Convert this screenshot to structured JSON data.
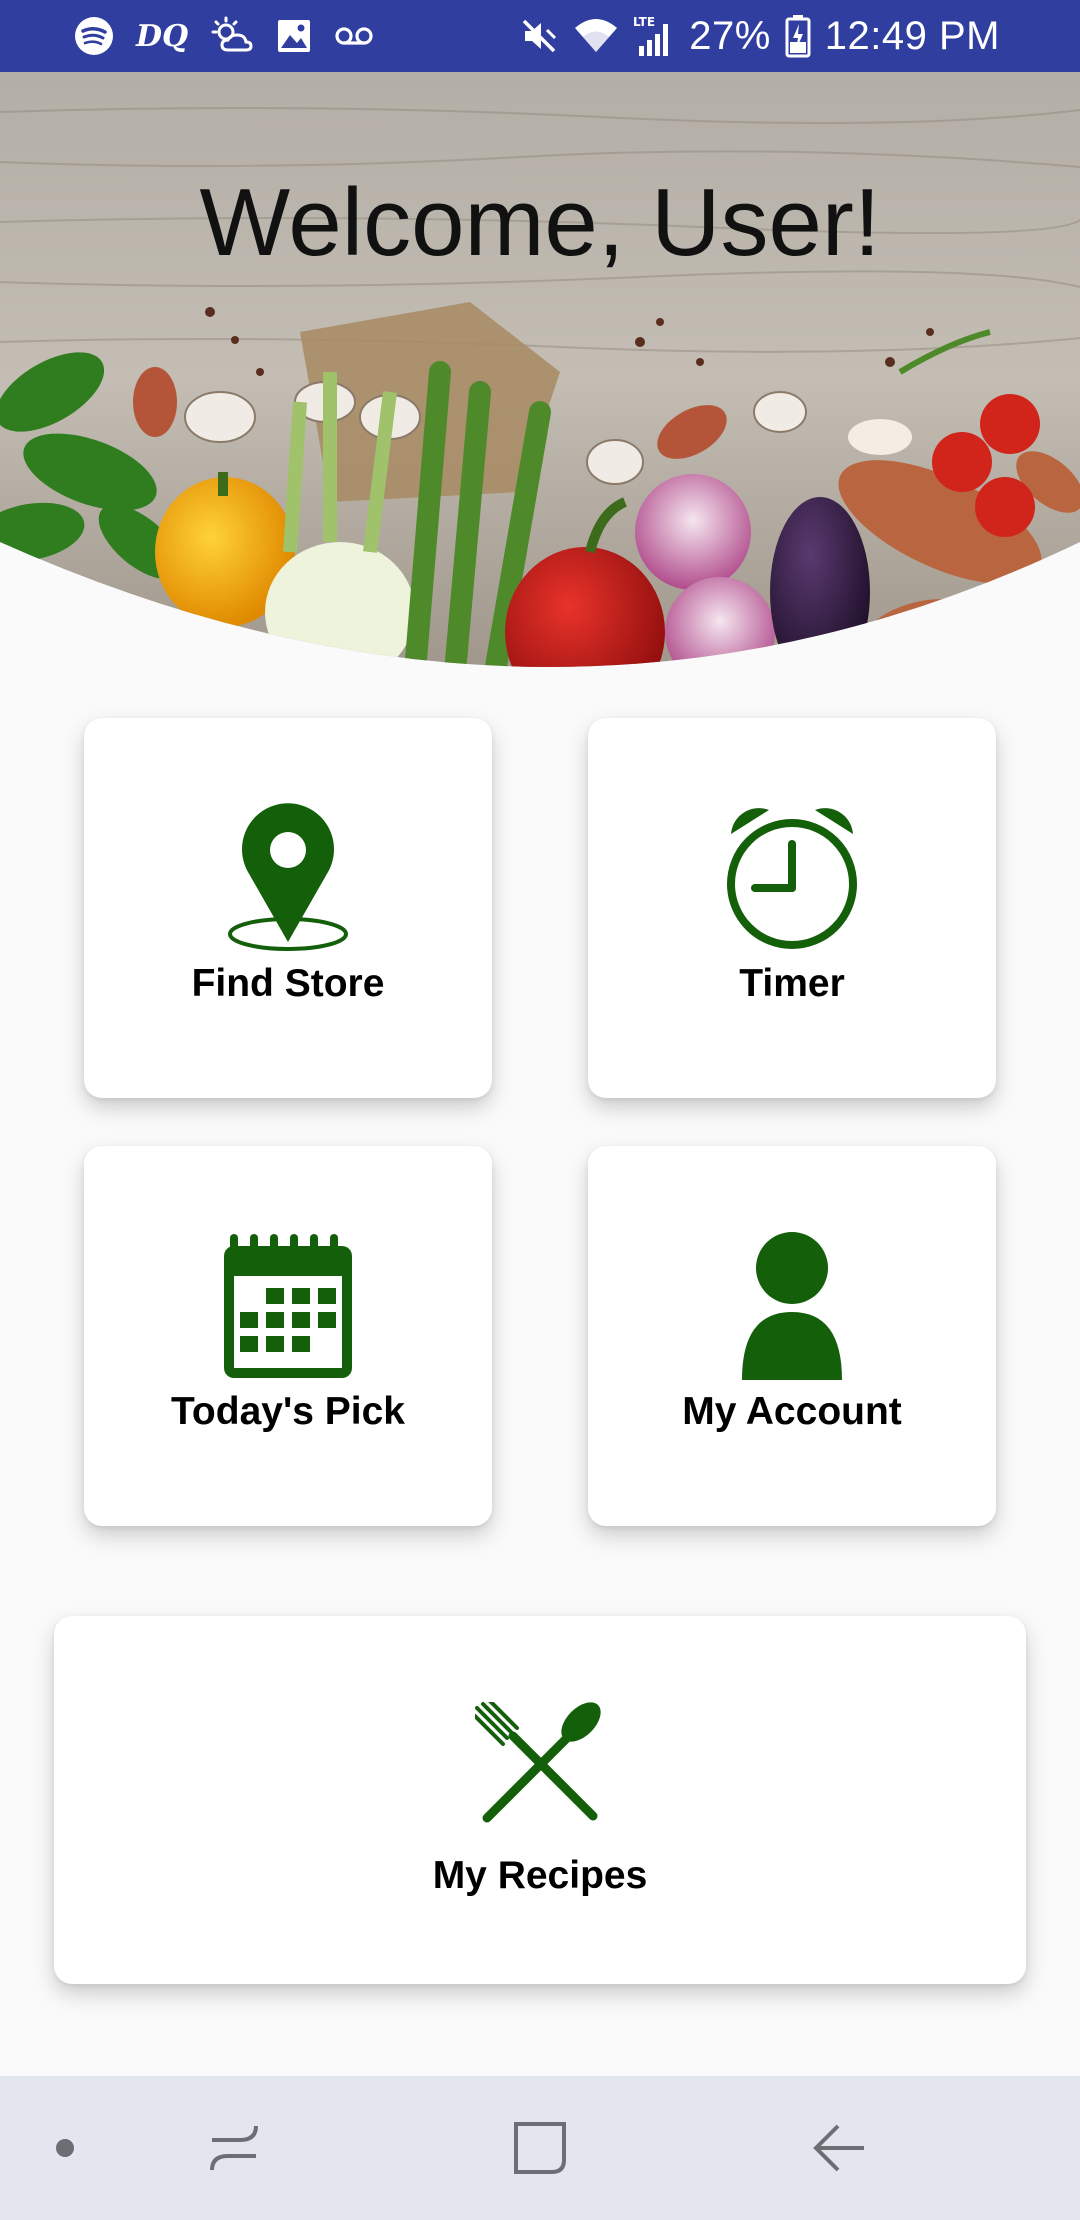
{
  "status_bar": {
    "battery": "27%",
    "time": "12:49 PM",
    "left_icons": [
      "spotify-icon",
      "dq-icon",
      "weather-icon",
      "image-icon",
      "voicemail-icon"
    ],
    "dq_text": "DQ",
    "right_icons": [
      "mute-icon",
      "wifi-icon",
      "lte-signal-icon",
      "battery-icon"
    ]
  },
  "header": {
    "welcome": "Welcome, User!"
  },
  "cards": {
    "find_store": {
      "label": "Find Store",
      "icon": "location-pin-icon"
    },
    "timer": {
      "label": "Timer",
      "icon": "alarm-clock-icon"
    },
    "todays_pick": {
      "label": "Today's Pick",
      "icon": "calendar-icon"
    },
    "my_account": {
      "label": "My Account",
      "icon": "person-icon"
    },
    "my_recipes": {
      "label": "My Recipes",
      "icon": "fork-spoon-icon"
    }
  },
  "colors": {
    "status_bar": "#303f9f",
    "icon_green": "#145f0a",
    "nav_bar": "#e3e5ef",
    "background": "#fafafa"
  },
  "nav_bar": {
    "items": [
      "dot-icon",
      "recent-apps-icon",
      "home-icon",
      "back-icon"
    ]
  }
}
